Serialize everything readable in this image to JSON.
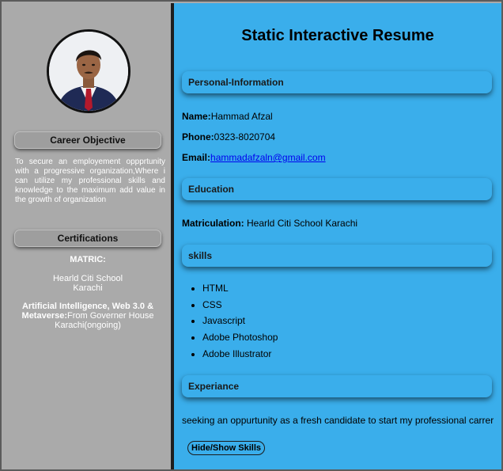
{
  "sidebar": {
    "career_objective_heading": "Career Objective",
    "career_objective_text": "To secure an employement oppprtunity with a progressive organization,Where i can utilize my professional skills and knowledge to the maximum add value in the growth of organization",
    "certifications_heading": "Certifications",
    "cert_matric_label": "MATRIC:",
    "cert_matric_school_line1": "Hearld Citi School",
    "cert_matric_school_line2": "Karachi",
    "cert_ai_label": "Artificial Intelligence, Web 3.0 & Metaverse:",
    "cert_ai_detail": "From Governer House Karachi(ongoing)"
  },
  "main": {
    "title": "Static Interactive Resume",
    "personal": {
      "heading": "Personal-Information",
      "name_label": "Name:",
      "name_value": "Hammad Afzal",
      "phone_label": "Phone:",
      "phone_value": "0323-8020704",
      "email_label": "Email:",
      "email_value": "hammadafzaln@gmail.com"
    },
    "education": {
      "heading": "Education",
      "label": "Matriculation:",
      "value": " Hearld Citi School Karachi"
    },
    "skills": {
      "heading": "skills",
      "items": [
        "HTML",
        "CSS",
        "Javascript",
        "Adobe Photoshop",
        "Adobe Illustrator"
      ]
    },
    "experience": {
      "heading": "Experiance",
      "text": "seeking an oppurtunity as a fresh candidate to start my professional carrer"
    },
    "toggle_button_label": "Hide/Show Skills"
  },
  "colors": {
    "sidebar_bg": "#aaaaaa",
    "main_bg": "#3aaeeb",
    "divider": "#1e1e1e",
    "link": "#0000ee"
  }
}
